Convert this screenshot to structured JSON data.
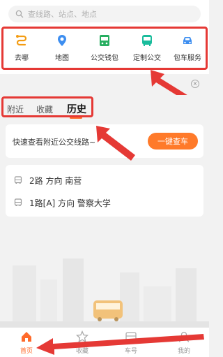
{
  "search": {
    "placeholder": "查线路、站点、地点"
  },
  "tools": [
    {
      "label": "去哪",
      "icon": "route-icon"
    },
    {
      "label": "地图",
      "icon": "map-pin-icon"
    },
    {
      "label": "公交钱包",
      "icon": "wallet-icon"
    },
    {
      "label": "定制公交",
      "icon": "custom-bus-icon"
    },
    {
      "label": "包车服务",
      "icon": "car-icon"
    }
  ],
  "tabs": [
    {
      "label": "附近",
      "active": false
    },
    {
      "label": "收藏",
      "active": false
    },
    {
      "label": "历史",
      "active": true
    }
  ],
  "nearby": {
    "prompt": "快速查看附近公交线路~",
    "button": "一键查车"
  },
  "history": [
    {
      "route": "2路 方向 南营"
    },
    {
      "route": "1路[A] 方向 警察大学"
    }
  ],
  "bottom_nav": [
    {
      "label": "首页",
      "active": true
    },
    {
      "label": "收藏",
      "active": false
    },
    {
      "label": "车号",
      "active": false
    },
    {
      "label": "我的",
      "active": false
    }
  ],
  "colors": {
    "accent": "#ff7a2a",
    "annotation": "#e53935",
    "tool_orange": "#f39c12",
    "tool_blue": "#3d8ef0",
    "tool_green": "#27ae60",
    "tool_teal": "#1abc9c"
  }
}
